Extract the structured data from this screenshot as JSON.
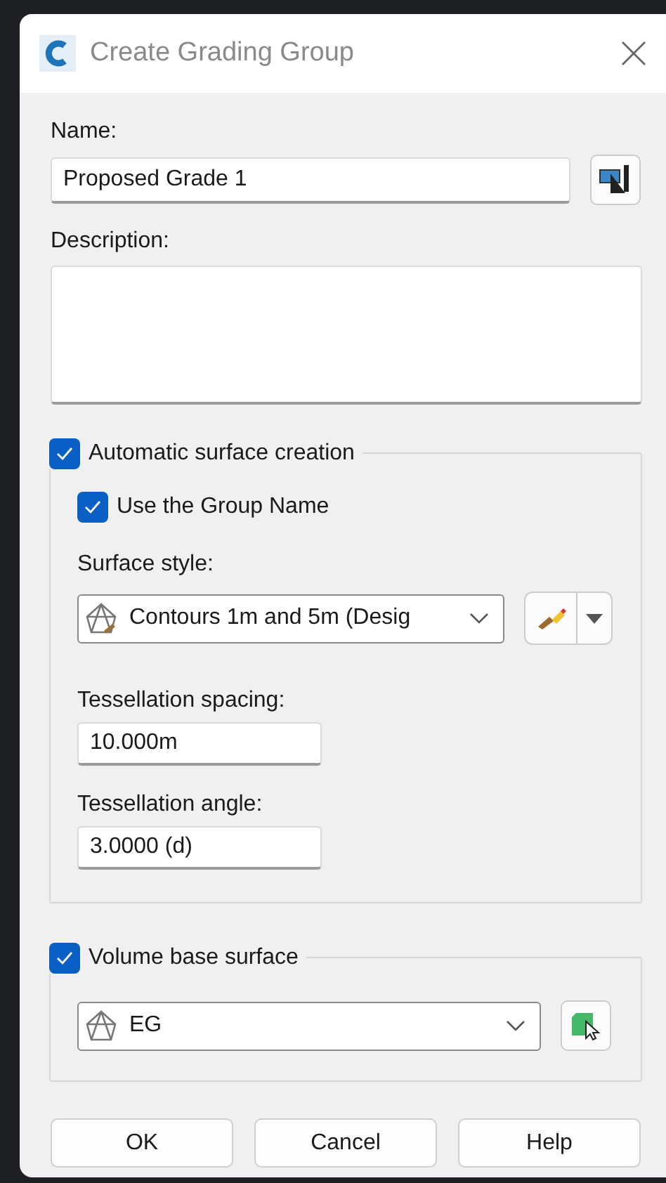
{
  "window": {
    "title": "Create Grading Group"
  },
  "name": {
    "label": "Name:",
    "value": "Proposed Grade 1"
  },
  "description": {
    "label": "Description:"
  },
  "automatic_surface": {
    "label": "Automatic surface creation",
    "checked": true,
    "use_group_name": {
      "label": "Use the Group Name",
      "checked": true
    },
    "surface_style": {
      "label": "Surface style:",
      "value": "Contours 1m and 5m (Desig"
    },
    "tessellation_spacing": {
      "label": "Tessellation spacing:",
      "value": "10.000m"
    },
    "tessellation_angle": {
      "label": "Tessellation angle:",
      "value": "3.0000 (d)"
    }
  },
  "volume_base": {
    "label": "Volume base surface",
    "checked": true,
    "surface": {
      "value": "EG"
    }
  },
  "buttons": [
    {
      "label": "OK"
    },
    {
      "label": "Cancel"
    },
    {
      "label": "Help"
    }
  ]
}
